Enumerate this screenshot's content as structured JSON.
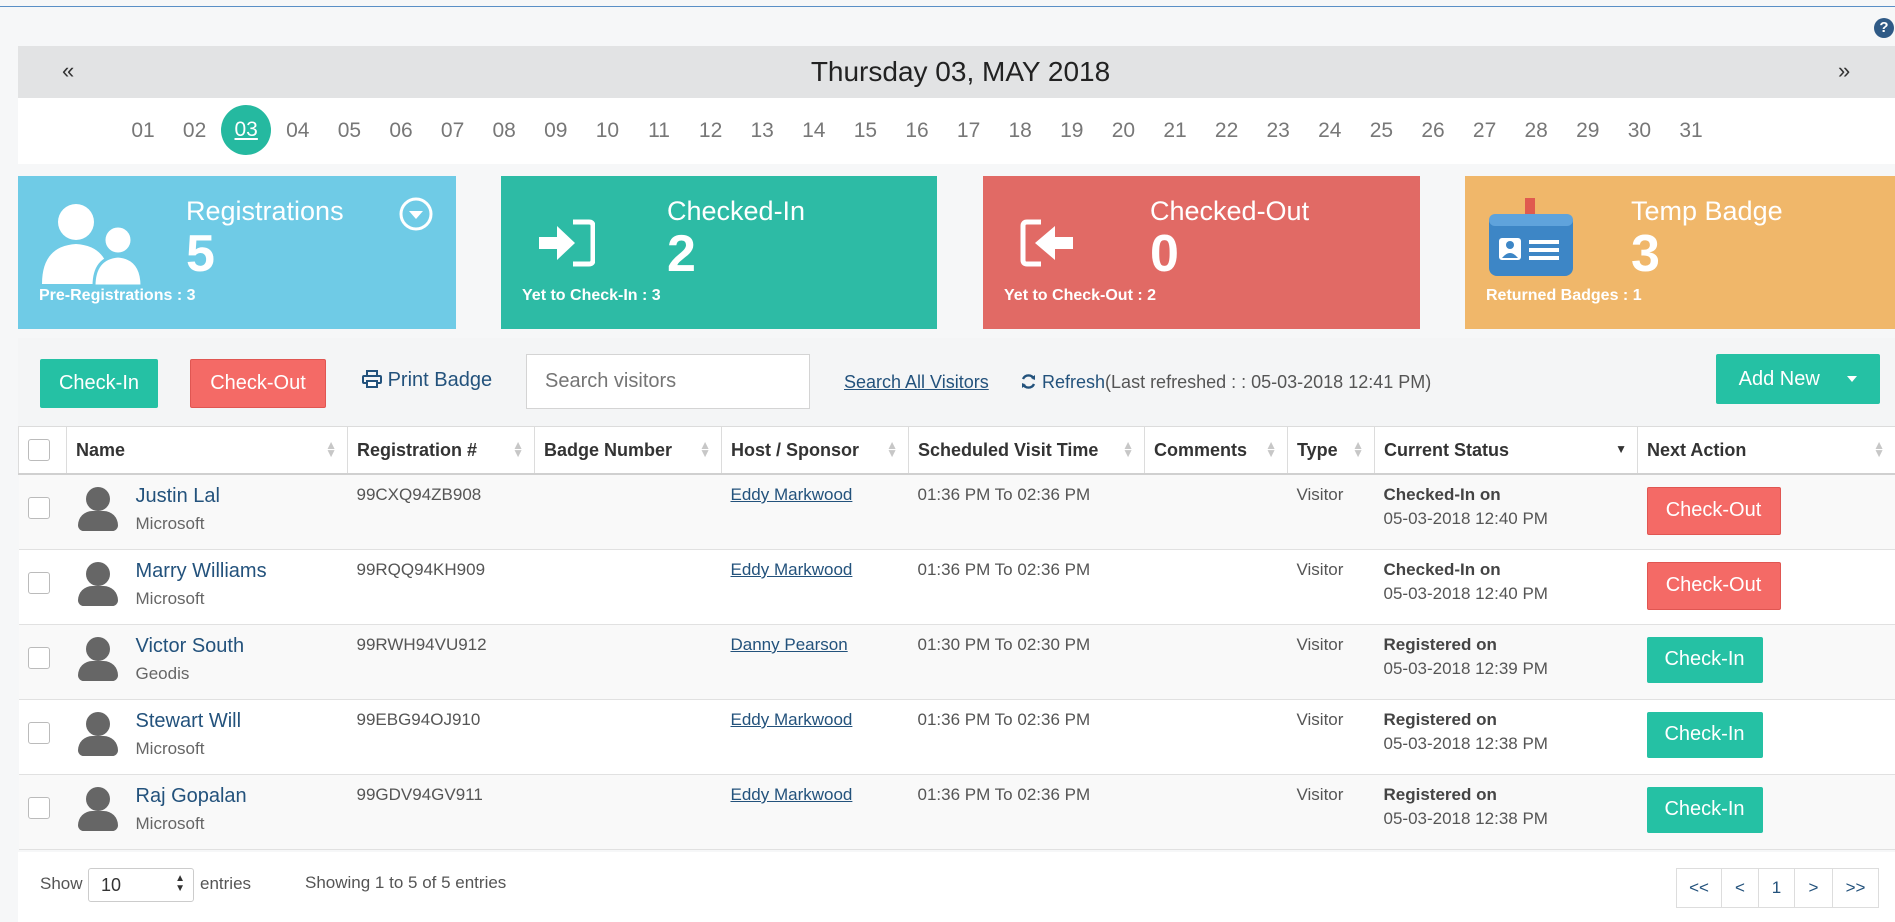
{
  "calendar": {
    "title": "Thursday 03, MAY 2018",
    "prev": "«",
    "next": "»",
    "days": [
      "01",
      "02",
      "03",
      "04",
      "05",
      "06",
      "07",
      "08",
      "09",
      "10",
      "11",
      "12",
      "13",
      "14",
      "15",
      "16",
      "17",
      "18",
      "19",
      "20",
      "21",
      "22",
      "23",
      "24",
      "25",
      "26",
      "27",
      "28",
      "29",
      "30",
      "31"
    ],
    "selected_day": "03"
  },
  "cards": {
    "registrations": {
      "title": "Registrations",
      "count": "5",
      "sub": "Pre-Registrations : 3",
      "color": "#6fcbe6"
    },
    "checked_in": {
      "title": "Checked-In",
      "count": "2",
      "sub": "Yet to Check-In : 3",
      "color": "#2dbba5"
    },
    "checked_out": {
      "title": "Checked-Out",
      "count": "0",
      "sub": "Yet to Check-Out : 2",
      "color": "#e16a65"
    },
    "temp_badge": {
      "title": "Temp Badge",
      "count": "3",
      "sub": "Returned Badges : 1",
      "color": "#f0b76a"
    }
  },
  "toolbar": {
    "checkin": "Check-In",
    "checkout": "Check-Out",
    "print_badge": "Print Badge",
    "search_placeholder": "Search visitors",
    "search_all": "Search All Visitors",
    "refresh": "Refresh",
    "last_refreshed": "(Last refreshed : : 05-03-2018 12:41 PM)",
    "add_new": "Add New"
  },
  "table": {
    "columns": [
      "Name",
      "Registration #",
      "Badge Number",
      "Host / Sponsor",
      "Scheduled Visit Time",
      "Comments",
      "Type",
      "Current Status",
      "Next Action"
    ],
    "rows": [
      {
        "name": "Justin Lal",
        "company": "Microsoft",
        "reg": "99CXQ94ZB908",
        "badge": "",
        "host": "Eddy Markwood",
        "time": "01:36 PM To 02:36 PM",
        "comments": "",
        "type": "Visitor",
        "status": "Checked-In on",
        "status_time": "05-03-2018 12:40 PM",
        "action": "Check-Out"
      },
      {
        "name": "Marry Williams",
        "company": "Microsoft",
        "reg": "99RQQ94KH909",
        "badge": "",
        "host": "Eddy Markwood",
        "time": "01:36 PM To 02:36 PM",
        "comments": "",
        "type": "Visitor",
        "status": "Checked-In on",
        "status_time": "05-03-2018 12:40 PM",
        "action": "Check-Out"
      },
      {
        "name": "Victor South",
        "company": "Geodis",
        "reg": "99RWH94VU912",
        "badge": "",
        "host": "Danny Pearson",
        "time": "01:30 PM To 02:30 PM",
        "comments": "",
        "type": "Visitor",
        "status": "Registered on",
        "status_time": "05-03-2018 12:39 PM",
        "action": "Check-In"
      },
      {
        "name": "Stewart Will",
        "company": "Microsoft",
        "reg": "99EBG94OJ910",
        "badge": "",
        "host": "Eddy Markwood",
        "time": "01:36 PM To 02:36 PM",
        "comments": "",
        "type": "Visitor",
        "status": "Registered on",
        "status_time": "05-03-2018 12:38 PM",
        "action": "Check-In"
      },
      {
        "name": "Raj Gopalan",
        "company": "Microsoft",
        "reg": "99GDV94GV911",
        "badge": "",
        "host": "Eddy Markwood",
        "time": "01:36 PM To 02:36 PM",
        "comments": "",
        "type": "Visitor",
        "status": "Registered on",
        "status_time": "05-03-2018 12:38 PM",
        "action": "Check-In"
      }
    ]
  },
  "footer": {
    "show": "Show",
    "entries_value": "10",
    "entries": "entries",
    "showing": "Showing 1 to 5 of 5 entries",
    "pager": [
      "<<",
      "<",
      "1",
      ">",
      ">>"
    ]
  },
  "help": "?"
}
